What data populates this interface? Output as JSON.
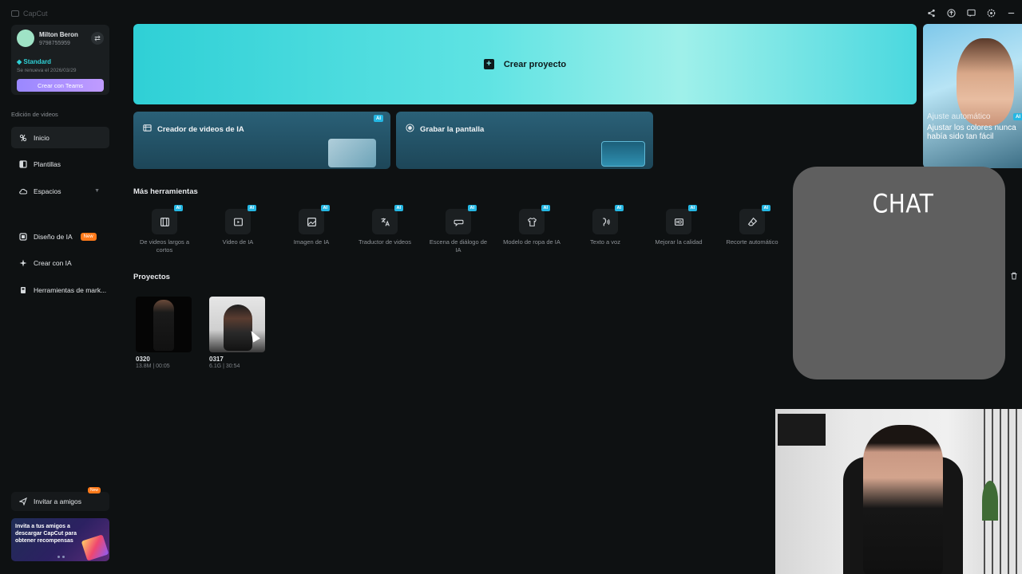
{
  "app": {
    "brand": "CapCut"
  },
  "topbar": {
    "icons": [
      "share-icon",
      "upload-icon",
      "feedback-icon",
      "settings-icon",
      "minimize-icon"
    ]
  },
  "account": {
    "name": "Milton Beron",
    "phone": "9798755959",
    "plan": "Standard",
    "renewal": "Se renueva el 2026/03/29",
    "teams_button": "Crear con Teams"
  },
  "sidebar": {
    "section_label": "Edición de videos",
    "items": [
      {
        "label": "Inicio",
        "icon": "home-icon"
      },
      {
        "label": "Plantillas",
        "icon": "templates-icon"
      },
      {
        "label": "Espacios",
        "icon": "cloud-icon"
      },
      {
        "label": "Diseño de IA",
        "icon": "ai-design-icon",
        "badge": "New"
      },
      {
        "label": "Crear con IA",
        "icon": "sparkle-icon"
      },
      {
        "label": "Herramientas de mark...",
        "icon": "marketing-icon"
      }
    ],
    "invite_label": "Invitar a amigos",
    "invite_badge": "New",
    "promo_text": "Invita a tus amigos a descargar CapCut para obtener recompensas"
  },
  "main": {
    "create_project": "Crear proyecto",
    "cards": [
      {
        "label": "Creador de videos de IA",
        "tag": "AI"
      },
      {
        "label": "Grabar la pantalla"
      }
    ],
    "side_promo": {
      "title": "Ajuste automático",
      "tag": "AI",
      "text": "Ajustar los colores nunca había sido tan fácil"
    },
    "tools_heading": "Más herramientas",
    "tools": [
      {
        "label": "De videos largos a cortos",
        "tag": "AI"
      },
      {
        "label": "Video de IA",
        "tag": "AI"
      },
      {
        "label": "Imagen de IA",
        "tag": "AI"
      },
      {
        "label": "Traductor de videos",
        "tag": "AI"
      },
      {
        "label": "Escena de diálogo de IA",
        "tag": "AI"
      },
      {
        "label": "Modelo de ropa de IA",
        "tag": "AI"
      },
      {
        "label": "Texto a voz",
        "tag": "AI"
      },
      {
        "label": "Mejorar la calidad",
        "tag": "AI"
      },
      {
        "label": "Recorte automático",
        "tag": "AI"
      }
    ],
    "projects_heading": "Proyectos",
    "projects": [
      {
        "name": "0320",
        "meta": "13.8M | 00:05"
      },
      {
        "name": "0317",
        "meta": "6.1G | 30:54"
      }
    ]
  },
  "overlay": {
    "chat_title": "CHAT"
  }
}
